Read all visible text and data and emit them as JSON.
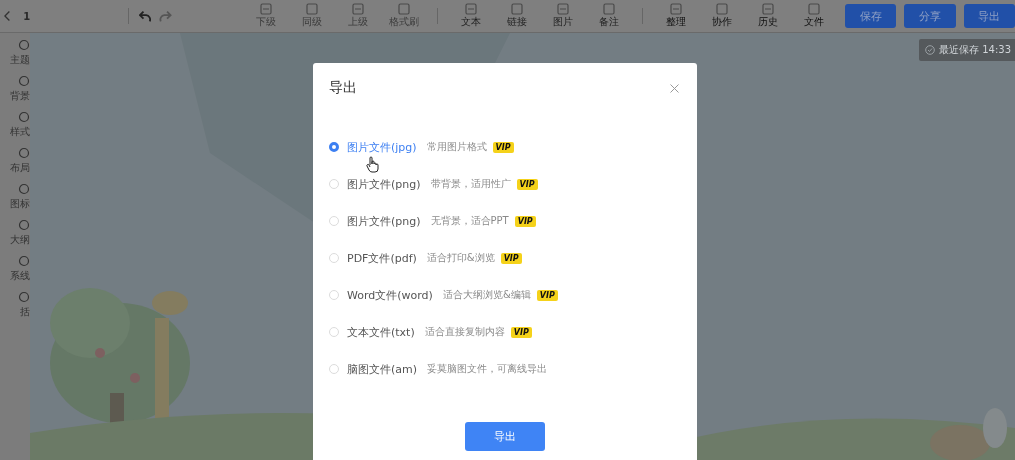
{
  "toolbar": {
    "page": "1",
    "tools": [
      {
        "label": "下级",
        "kind": "structure"
      },
      {
        "label": "同级",
        "kind": "structure"
      },
      {
        "label": "上级",
        "kind": "structure"
      },
      {
        "label": "格式刷",
        "kind": "structure"
      },
      {
        "label": "文本",
        "kind": "insert"
      },
      {
        "label": "链接",
        "kind": "insert"
      },
      {
        "label": "图片",
        "kind": "insert"
      },
      {
        "label": "备注",
        "kind": "insert"
      },
      {
        "label": "整理",
        "kind": "view"
      },
      {
        "label": "协作",
        "kind": "view"
      },
      {
        "label": "历史",
        "kind": "view"
      },
      {
        "label": "文件",
        "kind": "view"
      }
    ],
    "buttons": [
      "保存",
      "分享",
      "导出"
    ]
  },
  "save_status": "最近保存 14:33",
  "sidebar": {
    "items": [
      "主题",
      "背景",
      "样式",
      "布局",
      "图标",
      "大纲",
      "系线",
      "括"
    ]
  },
  "dialog": {
    "title": "导出",
    "options": [
      {
        "label": "图片文件(jpg)",
        "description": "常用图片格式",
        "badge": "VIP",
        "selected": true
      },
      {
        "label": "图片文件(png)",
        "description": "带背景，适用性广",
        "badge": "VIP",
        "selected": false
      },
      {
        "label": "图片文件(png)",
        "description": "无背景，适合PPT",
        "badge": "VIP",
        "selected": false
      },
      {
        "label": "PDF文件(pdf)",
        "description": "适合打印&浏览",
        "badge": "VIP",
        "selected": false
      },
      {
        "label": "Word文件(word)",
        "description": "适合大纲浏览&编辑",
        "badge": "VIP",
        "selected": false
      },
      {
        "label": "文本文件(txt)",
        "description": "适合直接复制内容",
        "badge": "VIP",
        "selected": false
      },
      {
        "label": "脑图文件(am)",
        "description": "妥莫脑图文件，可离线导出",
        "selected": false
      }
    ],
    "button": "导出"
  }
}
